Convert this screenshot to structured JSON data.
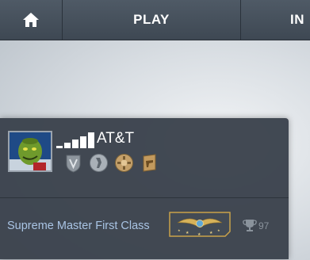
{
  "nav": {
    "home_icon": "home-icon",
    "play_label": "PLAY",
    "inventory_label_partial": "IN"
  },
  "profile": {
    "name": "AT&T",
    "signal_icon": "signal-bars-icon",
    "medals": [
      "service-medal-icon",
      "coin-medal-icon",
      "operation-coin-icon",
      "map-coin-icon"
    ]
  },
  "rank": {
    "label": "Supreme Master First Class",
    "badge_icon": "supreme-rank-icon",
    "wins": "97",
    "trophy_icon": "trophy-icon"
  },
  "colors": {
    "nav_bg": "#46505b",
    "card_bg": "#3a424c",
    "rank_text": "#a9c4e4",
    "gold": "#c9a24a"
  }
}
